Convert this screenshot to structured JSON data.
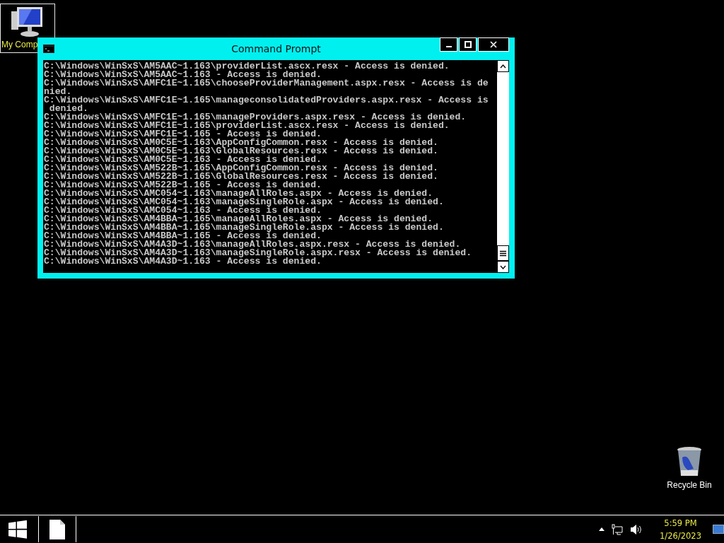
{
  "desktop_icons": [
    {
      "kind": "computer",
      "label": "My Comp",
      "selected": true
    },
    {
      "kind": "recycle",
      "label": "Recycle Bin",
      "selected": false
    }
  ],
  "window": {
    "title": "Command Prompt",
    "lines": [
      "C:\\Windows\\WinSxS\\AM5AAC~1.163\\providerList.ascx.resx - Access is denied.",
      "C:\\Windows\\WinSxS\\AM5AAC~1.163 - Access is denied.",
      "C:\\Windows\\WinSxS\\AMFC1E~1.165\\chooseProviderManagement.aspx.resx - Access is de",
      "nied.",
      "C:\\Windows\\WinSxS\\AMFC1E~1.165\\manageconsolidatedProviders.aspx.resx - Access is",
      " denied.",
      "C:\\Windows\\WinSxS\\AMFC1E~1.165\\manageProviders.aspx.resx - Access is denied.",
      "C:\\Windows\\WinSxS\\AMFC1E~1.165\\providerList.ascx.resx - Access is denied.",
      "C:\\Windows\\WinSxS\\AMFC1E~1.165 - Access is denied.",
      "C:\\Windows\\WinSxS\\AM0C5E~1.163\\AppConfigCommon.resx - Access is denied.",
      "C:\\Windows\\WinSxS\\AM0C5E~1.163\\GlobalResources.resx - Access is denied.",
      "C:\\Windows\\WinSxS\\AM0C5E~1.163 - Access is denied.",
      "C:\\Windows\\WinSxS\\AM522B~1.165\\AppConfigCommon.resx - Access is denied.",
      "C:\\Windows\\WinSxS\\AM522B~1.165\\GlobalResources.resx - Access is denied.",
      "C:\\Windows\\WinSxS\\AM522B~1.165 - Access is denied.",
      "C:\\Windows\\WinSxS\\AMC054~1.163\\manageAllRoles.aspx - Access is denied.",
      "C:\\Windows\\WinSxS\\AMC054~1.163\\manageSingleRole.aspx - Access is denied.",
      "C:\\Windows\\WinSxS\\AMC054~1.163 - Access is denied.",
      "C:\\Windows\\WinSxS\\AM4BBA~1.165\\manageAllRoles.aspx - Access is denied.",
      "C:\\Windows\\WinSxS\\AM4BBA~1.165\\manageSingleRole.aspx - Access is denied.",
      "C:\\Windows\\WinSxS\\AM4BBA~1.165 - Access is denied.",
      "C:\\Windows\\WinSxS\\AM4A3D~1.163\\manageAllRoles.aspx.resx - Access is denied.",
      "C:\\Windows\\WinSxS\\AM4A3D~1.163\\manageSingleRole.aspx.resx - Access is denied.",
      "C:\\Windows\\WinSxS\\AM4A3D~1.163 - Access is denied."
    ]
  },
  "taskbar": {
    "items": [
      {
        "kind": "file",
        "active": true
      }
    ],
    "time": "5:59 PM",
    "date": "1/26/2023"
  }
}
